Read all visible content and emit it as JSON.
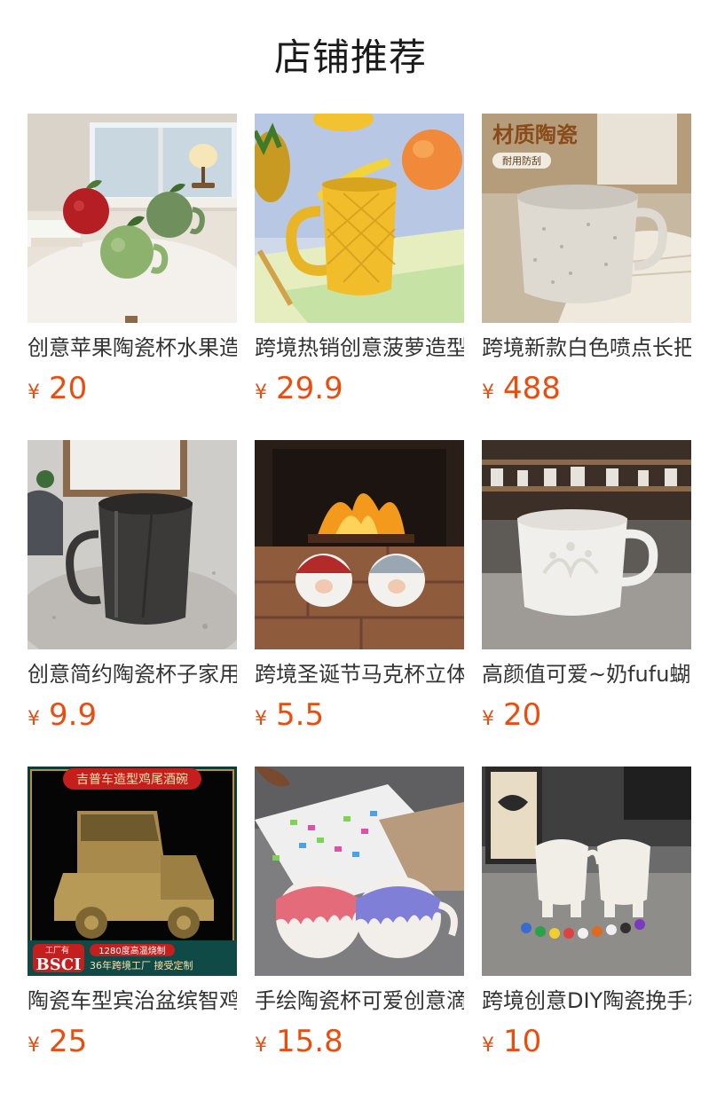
{
  "section_title": "店铺推荐",
  "products": [
    {
      "name": "创意苹果陶瓷杯水果造型马克杯",
      "currency": "¥",
      "price": "20",
      "image": "apple-mugs-photo"
    },
    {
      "name": "跨境热销创意菠萝造型陶瓷杯",
      "currency": "¥",
      "price": "29.9",
      "image": "pineapple-mug-photo"
    },
    {
      "name": "跨境新款白色喷点长把咖啡杯",
      "currency": "¥",
      "price": "488",
      "image": "speckled-mug-photo",
      "image_text": {
        "headline": "材质陶瓷",
        "badge": "耐用防刮"
      }
    },
    {
      "name": "创意简约陶瓷杯子家用马克杯",
      "currency": "¥",
      "price": "9.9",
      "image": "black-mug-photo"
    },
    {
      "name": "跨境圣诞节马克杯立体老人杯",
      "currency": "¥",
      "price": "5.5",
      "image": "santa-mugs-photo"
    },
    {
      "name": "高颜值可爱~奶fufu蝴蝶结马克杯",
      "currency": "¥",
      "price": "20",
      "image": "embossed-mug-photo"
    },
    {
      "name": "陶瓷车型宾治盆缤智鸡尾酒碗",
      "currency": "¥",
      "price": "25",
      "image": "car-bowl-photo",
      "image_text": {
        "banner": "吉普车造型鸡尾酒碗",
        "factory": "工厂有",
        "cert": "BSCI",
        "firing": "1280度高温烧制",
        "years": "36年跨境工厂  接受定制"
      }
    },
    {
      "name": "手绘陶瓷杯可爱创意滴釉马克杯",
      "currency": "¥",
      "price": "15.8",
      "image": "drip-mugs-photo"
    },
    {
      "name": "跨境创意DIY陶瓷挽手杯",
      "currency": "¥",
      "price": "10",
      "image": "diy-mugs-photo"
    }
  ]
}
